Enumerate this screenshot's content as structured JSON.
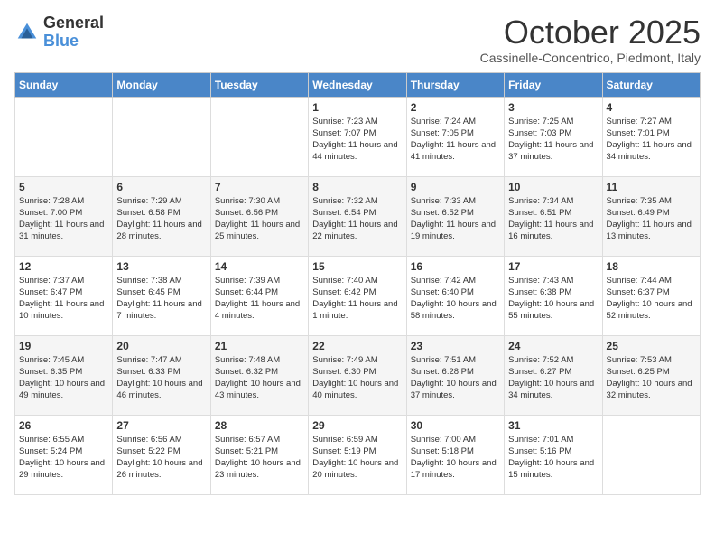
{
  "header": {
    "logo_general": "General",
    "logo_blue": "Blue",
    "month_title": "October 2025",
    "subtitle": "Cassinelle-Concentrico, Piedmont, Italy"
  },
  "days_of_week": [
    "Sunday",
    "Monday",
    "Tuesday",
    "Wednesday",
    "Thursday",
    "Friday",
    "Saturday"
  ],
  "weeks": [
    [
      {
        "day": "",
        "info": ""
      },
      {
        "day": "",
        "info": ""
      },
      {
        "day": "",
        "info": ""
      },
      {
        "day": "1",
        "info": "Sunrise: 7:23 AM\nSunset: 7:07 PM\nDaylight: 11 hours and 44 minutes."
      },
      {
        "day": "2",
        "info": "Sunrise: 7:24 AM\nSunset: 7:05 PM\nDaylight: 11 hours and 41 minutes."
      },
      {
        "day": "3",
        "info": "Sunrise: 7:25 AM\nSunset: 7:03 PM\nDaylight: 11 hours and 37 minutes."
      },
      {
        "day": "4",
        "info": "Sunrise: 7:27 AM\nSunset: 7:01 PM\nDaylight: 11 hours and 34 minutes."
      }
    ],
    [
      {
        "day": "5",
        "info": "Sunrise: 7:28 AM\nSunset: 7:00 PM\nDaylight: 11 hours and 31 minutes."
      },
      {
        "day": "6",
        "info": "Sunrise: 7:29 AM\nSunset: 6:58 PM\nDaylight: 11 hours and 28 minutes."
      },
      {
        "day": "7",
        "info": "Sunrise: 7:30 AM\nSunset: 6:56 PM\nDaylight: 11 hours and 25 minutes."
      },
      {
        "day": "8",
        "info": "Sunrise: 7:32 AM\nSunset: 6:54 PM\nDaylight: 11 hours and 22 minutes."
      },
      {
        "day": "9",
        "info": "Sunrise: 7:33 AM\nSunset: 6:52 PM\nDaylight: 11 hours and 19 minutes."
      },
      {
        "day": "10",
        "info": "Sunrise: 7:34 AM\nSunset: 6:51 PM\nDaylight: 11 hours and 16 minutes."
      },
      {
        "day": "11",
        "info": "Sunrise: 7:35 AM\nSunset: 6:49 PM\nDaylight: 11 hours and 13 minutes."
      }
    ],
    [
      {
        "day": "12",
        "info": "Sunrise: 7:37 AM\nSunset: 6:47 PM\nDaylight: 11 hours and 10 minutes."
      },
      {
        "day": "13",
        "info": "Sunrise: 7:38 AM\nSunset: 6:45 PM\nDaylight: 11 hours and 7 minutes."
      },
      {
        "day": "14",
        "info": "Sunrise: 7:39 AM\nSunset: 6:44 PM\nDaylight: 11 hours and 4 minutes."
      },
      {
        "day": "15",
        "info": "Sunrise: 7:40 AM\nSunset: 6:42 PM\nDaylight: 11 hours and 1 minute."
      },
      {
        "day": "16",
        "info": "Sunrise: 7:42 AM\nSunset: 6:40 PM\nDaylight: 10 hours and 58 minutes."
      },
      {
        "day": "17",
        "info": "Sunrise: 7:43 AM\nSunset: 6:38 PM\nDaylight: 10 hours and 55 minutes."
      },
      {
        "day": "18",
        "info": "Sunrise: 7:44 AM\nSunset: 6:37 PM\nDaylight: 10 hours and 52 minutes."
      }
    ],
    [
      {
        "day": "19",
        "info": "Sunrise: 7:45 AM\nSunset: 6:35 PM\nDaylight: 10 hours and 49 minutes."
      },
      {
        "day": "20",
        "info": "Sunrise: 7:47 AM\nSunset: 6:33 PM\nDaylight: 10 hours and 46 minutes."
      },
      {
        "day": "21",
        "info": "Sunrise: 7:48 AM\nSunset: 6:32 PM\nDaylight: 10 hours and 43 minutes."
      },
      {
        "day": "22",
        "info": "Sunrise: 7:49 AM\nSunset: 6:30 PM\nDaylight: 10 hours and 40 minutes."
      },
      {
        "day": "23",
        "info": "Sunrise: 7:51 AM\nSunset: 6:28 PM\nDaylight: 10 hours and 37 minutes."
      },
      {
        "day": "24",
        "info": "Sunrise: 7:52 AM\nSunset: 6:27 PM\nDaylight: 10 hours and 34 minutes."
      },
      {
        "day": "25",
        "info": "Sunrise: 7:53 AM\nSunset: 6:25 PM\nDaylight: 10 hours and 32 minutes."
      }
    ],
    [
      {
        "day": "26",
        "info": "Sunrise: 6:55 AM\nSunset: 5:24 PM\nDaylight: 10 hours and 29 minutes."
      },
      {
        "day": "27",
        "info": "Sunrise: 6:56 AM\nSunset: 5:22 PM\nDaylight: 10 hours and 26 minutes."
      },
      {
        "day": "28",
        "info": "Sunrise: 6:57 AM\nSunset: 5:21 PM\nDaylight: 10 hours and 23 minutes."
      },
      {
        "day": "29",
        "info": "Sunrise: 6:59 AM\nSunset: 5:19 PM\nDaylight: 10 hours and 20 minutes."
      },
      {
        "day": "30",
        "info": "Sunrise: 7:00 AM\nSunset: 5:18 PM\nDaylight: 10 hours and 17 minutes."
      },
      {
        "day": "31",
        "info": "Sunrise: 7:01 AM\nSunset: 5:16 PM\nDaylight: 10 hours and 15 minutes."
      },
      {
        "day": "",
        "info": ""
      }
    ]
  ]
}
